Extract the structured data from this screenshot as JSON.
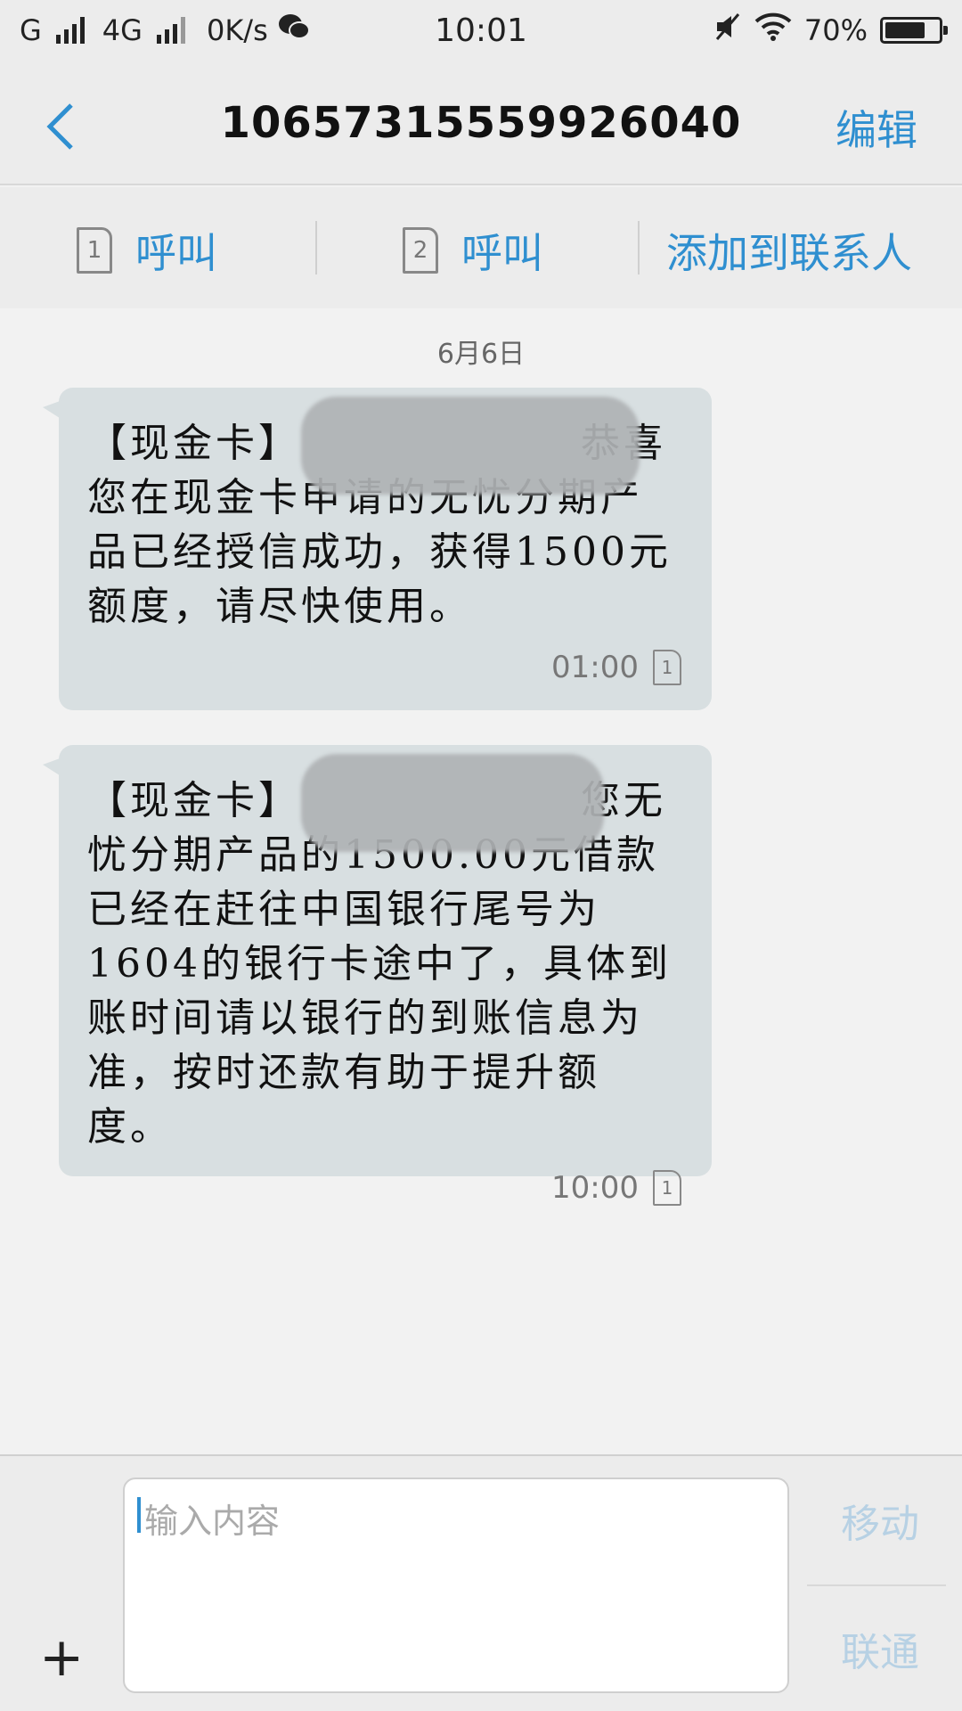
{
  "status_bar": {
    "carrier1": "G",
    "carrier2": "4G",
    "speed": "0K/s",
    "time": "10:01",
    "battery": "70%",
    "battery_level": 0.7,
    "icons": [
      "signal-icon",
      "wechat-icon",
      "mute-icon",
      "wifi-icon",
      "battery-icon"
    ]
  },
  "header": {
    "title": "10657315559926040",
    "edit_label": "编辑"
  },
  "actions": {
    "call1_sim": "1",
    "call1_label": "呼叫",
    "call2_sim": "2",
    "call2_label": "呼叫",
    "add_contact": "添加到联系人"
  },
  "conversation": {
    "date": "6月6日",
    "messages": [
      {
        "text": "【现金卡】　　　　　　　恭喜您在现金卡申请的无忧分期产品已经授信成功，获得1500元额度，请尽快使用。",
        "time": "01:00",
        "sim": "1"
      },
      {
        "text": "【现金卡】　　　　　　　您无忧分期产品的1500.00元借款已经在赶往中国银行尾号为1604的银行卡途中了，具体到账时间请以银行的到账信息为准，按时还款有助于提升额度。",
        "time": "10:00",
        "sim": "1"
      }
    ]
  },
  "composer": {
    "add_symbol": "+",
    "placeholder": "输入内容",
    "send_mobile": "移动",
    "send_unicom": "联通"
  },
  "colors": {
    "accent": "#2f8fd0",
    "bubble": "#d8dfe1",
    "background": "#f2f2f2"
  }
}
